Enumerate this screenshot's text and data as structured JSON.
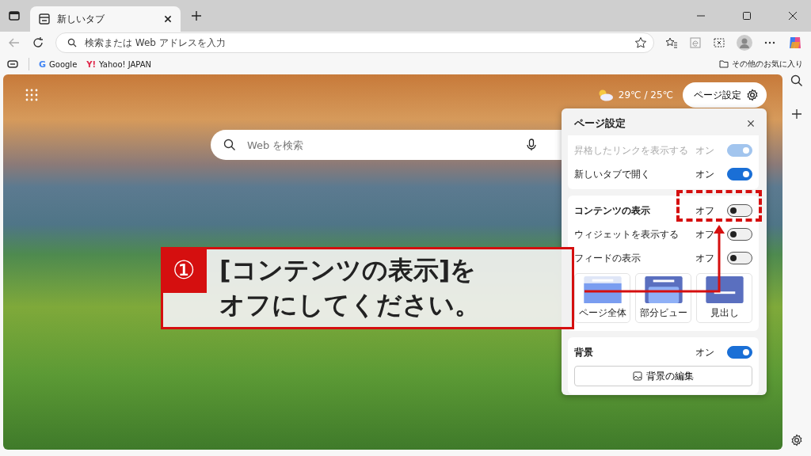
{
  "tab": {
    "title": "新しいタブ"
  },
  "address_bar": {
    "placeholder": "検索または Web アドレスを入力"
  },
  "bookmarks": [
    {
      "label": "Google",
      "kind": "google",
      "logo": "G"
    },
    {
      "label": "Yahoo! JAPAN",
      "kind": "yahoo",
      "logo": "Y!"
    }
  ],
  "other_favorites": "その他のお気に入り",
  "new_tab_page": {
    "weather": "29℃ / 25℃",
    "page_settings_button": "ページ設定",
    "search": {
      "placeholder": "Web を検索"
    }
  },
  "settings_panel": {
    "title": "ページ設定",
    "sections": [
      {
        "rows": [
          {
            "label": "昇格したリンクを表示する",
            "state": "オン",
            "on": true,
            "disabled": true
          },
          {
            "label": "新しいタブで開く",
            "state": "オン",
            "on": true,
            "disabled": false
          }
        ]
      },
      {
        "rows": [
          {
            "label": "コンテンツの表示",
            "state": "オフ",
            "on": false,
            "disabled": false,
            "heading": true
          },
          {
            "label": "ウィジェットを表示する",
            "state": "オフ",
            "on": false,
            "disabled": false
          },
          {
            "label": "フィードの表示",
            "state": "オフ",
            "on": false,
            "disabled": false
          }
        ],
        "layouts": [
          {
            "label": "ページ全体",
            "kind": "full"
          },
          {
            "label": "部分ビュー",
            "kind": "partial"
          },
          {
            "label": "見出し",
            "kind": "headline"
          }
        ]
      },
      {
        "rows": [
          {
            "label": "背景",
            "state": "オン",
            "on": true,
            "disabled": false,
            "heading": true
          }
        ],
        "button": "背景の編集"
      }
    ]
  },
  "callout": {
    "number": "①",
    "lines": [
      "[コンテンツの表示]を",
      "オフにしてください。"
    ]
  }
}
